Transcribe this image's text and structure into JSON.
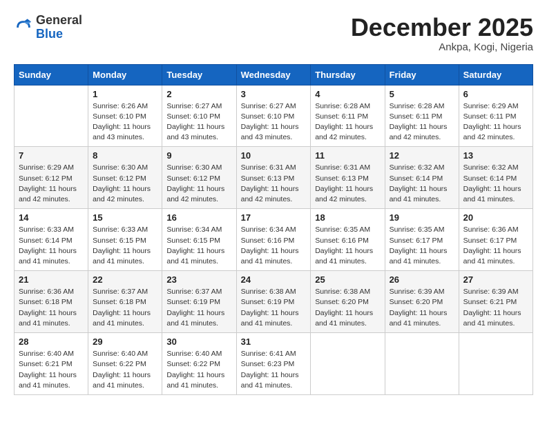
{
  "logo": {
    "general": "General",
    "blue": "Blue"
  },
  "title": "December 2025",
  "location": "Ankpa, Kogi, Nigeria",
  "weekdays": [
    "Sunday",
    "Monday",
    "Tuesday",
    "Wednesday",
    "Thursday",
    "Friday",
    "Saturday"
  ],
  "weeks": [
    [
      {
        "day": "",
        "info": ""
      },
      {
        "day": "1",
        "info": "Sunrise: 6:26 AM\nSunset: 6:10 PM\nDaylight: 11 hours\nand 43 minutes."
      },
      {
        "day": "2",
        "info": "Sunrise: 6:27 AM\nSunset: 6:10 PM\nDaylight: 11 hours\nand 43 minutes."
      },
      {
        "day": "3",
        "info": "Sunrise: 6:27 AM\nSunset: 6:10 PM\nDaylight: 11 hours\nand 43 minutes."
      },
      {
        "day": "4",
        "info": "Sunrise: 6:28 AM\nSunset: 6:11 PM\nDaylight: 11 hours\nand 42 minutes."
      },
      {
        "day": "5",
        "info": "Sunrise: 6:28 AM\nSunset: 6:11 PM\nDaylight: 11 hours\nand 42 minutes."
      },
      {
        "day": "6",
        "info": "Sunrise: 6:29 AM\nSunset: 6:11 PM\nDaylight: 11 hours\nand 42 minutes."
      }
    ],
    [
      {
        "day": "7",
        "info": "Sunrise: 6:29 AM\nSunset: 6:12 PM\nDaylight: 11 hours\nand 42 minutes."
      },
      {
        "day": "8",
        "info": "Sunrise: 6:30 AM\nSunset: 6:12 PM\nDaylight: 11 hours\nand 42 minutes."
      },
      {
        "day": "9",
        "info": "Sunrise: 6:30 AM\nSunset: 6:12 PM\nDaylight: 11 hours\nand 42 minutes."
      },
      {
        "day": "10",
        "info": "Sunrise: 6:31 AM\nSunset: 6:13 PM\nDaylight: 11 hours\nand 42 minutes."
      },
      {
        "day": "11",
        "info": "Sunrise: 6:31 AM\nSunset: 6:13 PM\nDaylight: 11 hours\nand 42 minutes."
      },
      {
        "day": "12",
        "info": "Sunrise: 6:32 AM\nSunset: 6:14 PM\nDaylight: 11 hours\nand 41 minutes."
      },
      {
        "day": "13",
        "info": "Sunrise: 6:32 AM\nSunset: 6:14 PM\nDaylight: 11 hours\nand 41 minutes."
      }
    ],
    [
      {
        "day": "14",
        "info": "Sunrise: 6:33 AM\nSunset: 6:14 PM\nDaylight: 11 hours\nand 41 minutes."
      },
      {
        "day": "15",
        "info": "Sunrise: 6:33 AM\nSunset: 6:15 PM\nDaylight: 11 hours\nand 41 minutes."
      },
      {
        "day": "16",
        "info": "Sunrise: 6:34 AM\nSunset: 6:15 PM\nDaylight: 11 hours\nand 41 minutes."
      },
      {
        "day": "17",
        "info": "Sunrise: 6:34 AM\nSunset: 6:16 PM\nDaylight: 11 hours\nand 41 minutes."
      },
      {
        "day": "18",
        "info": "Sunrise: 6:35 AM\nSunset: 6:16 PM\nDaylight: 11 hours\nand 41 minutes."
      },
      {
        "day": "19",
        "info": "Sunrise: 6:35 AM\nSunset: 6:17 PM\nDaylight: 11 hours\nand 41 minutes."
      },
      {
        "day": "20",
        "info": "Sunrise: 6:36 AM\nSunset: 6:17 PM\nDaylight: 11 hours\nand 41 minutes."
      }
    ],
    [
      {
        "day": "21",
        "info": "Sunrise: 6:36 AM\nSunset: 6:18 PM\nDaylight: 11 hours\nand 41 minutes."
      },
      {
        "day": "22",
        "info": "Sunrise: 6:37 AM\nSunset: 6:18 PM\nDaylight: 11 hours\nand 41 minutes."
      },
      {
        "day": "23",
        "info": "Sunrise: 6:37 AM\nSunset: 6:19 PM\nDaylight: 11 hours\nand 41 minutes."
      },
      {
        "day": "24",
        "info": "Sunrise: 6:38 AM\nSunset: 6:19 PM\nDaylight: 11 hours\nand 41 minutes."
      },
      {
        "day": "25",
        "info": "Sunrise: 6:38 AM\nSunset: 6:20 PM\nDaylight: 11 hours\nand 41 minutes."
      },
      {
        "day": "26",
        "info": "Sunrise: 6:39 AM\nSunset: 6:20 PM\nDaylight: 11 hours\nand 41 minutes."
      },
      {
        "day": "27",
        "info": "Sunrise: 6:39 AM\nSunset: 6:21 PM\nDaylight: 11 hours\nand 41 minutes."
      }
    ],
    [
      {
        "day": "28",
        "info": "Sunrise: 6:40 AM\nSunset: 6:21 PM\nDaylight: 11 hours\nand 41 minutes."
      },
      {
        "day": "29",
        "info": "Sunrise: 6:40 AM\nSunset: 6:22 PM\nDaylight: 11 hours\nand 41 minutes."
      },
      {
        "day": "30",
        "info": "Sunrise: 6:40 AM\nSunset: 6:22 PM\nDaylight: 11 hours\nand 41 minutes."
      },
      {
        "day": "31",
        "info": "Sunrise: 6:41 AM\nSunset: 6:23 PM\nDaylight: 11 hours\nand 41 minutes."
      },
      {
        "day": "",
        "info": ""
      },
      {
        "day": "",
        "info": ""
      },
      {
        "day": "",
        "info": ""
      }
    ]
  ]
}
